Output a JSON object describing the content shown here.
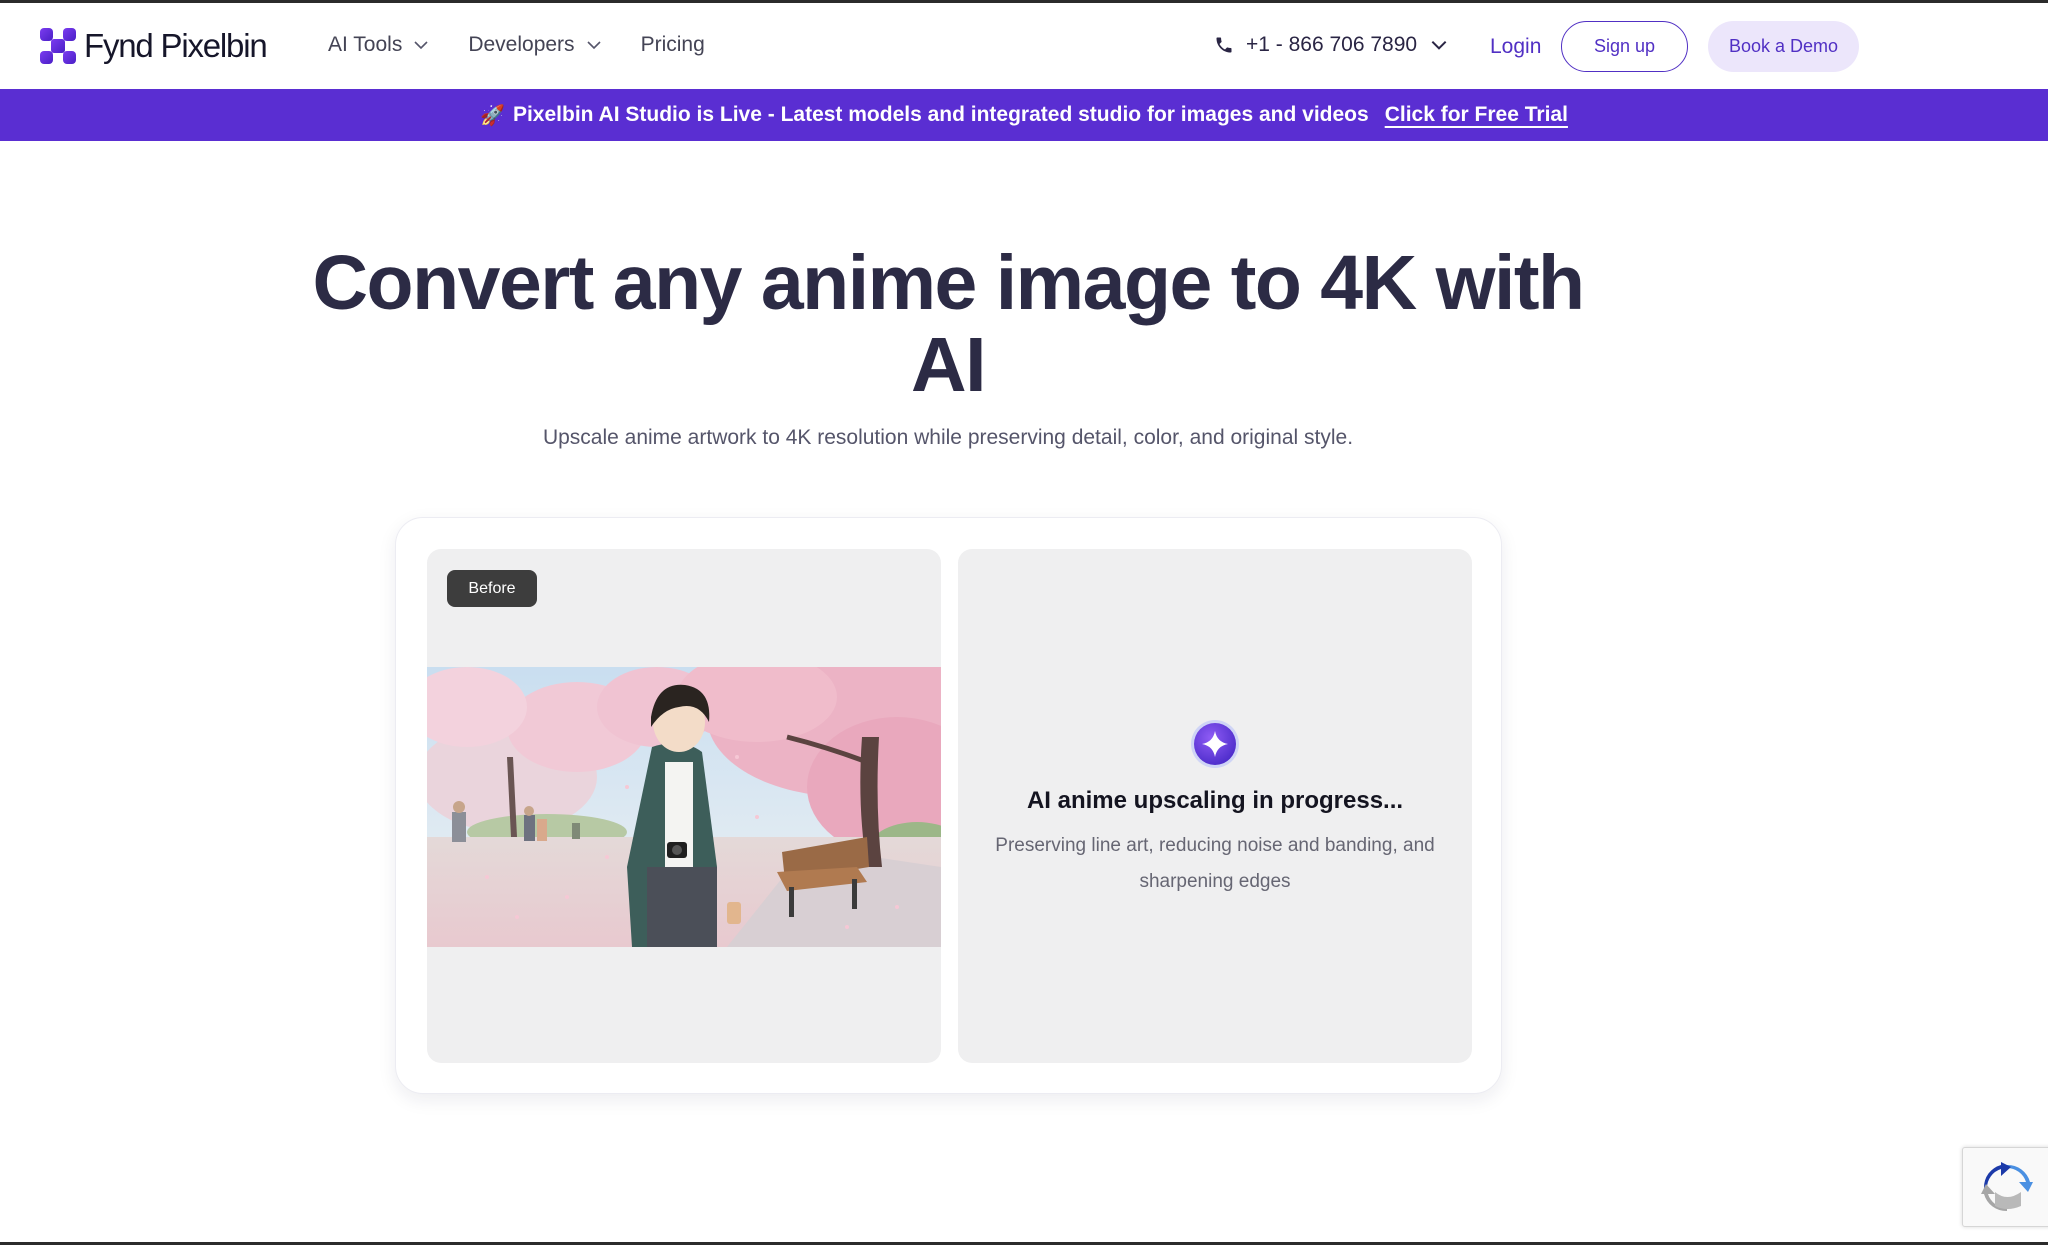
{
  "brand": {
    "name": "Fynd Pixelbin"
  },
  "nav": {
    "links": [
      {
        "label": "AI Tools",
        "has_dropdown": true
      },
      {
        "label": "Developers",
        "has_dropdown": true
      },
      {
        "label": "Pricing",
        "has_dropdown": false
      }
    ],
    "phone": "+1 - 866 706 7890",
    "login": "Login",
    "signup": "Sign up",
    "demo": "Book a Demo"
  },
  "banner": {
    "icon": "rocket-icon",
    "text": "Pixelbin AI Studio is Live - Latest models and integrated studio for images and videos",
    "cta": "Click for Free Trial"
  },
  "hero": {
    "title": "Convert any anime image to 4K with AI",
    "subtitle": "Upscale anime artwork to 4K resolution while preserving detail, color, and original style."
  },
  "preview": {
    "before_label": "Before",
    "image_alt": "anime boy under cherry blossom trees",
    "progress_title": "AI anime upscaling in progress...",
    "progress_desc": "Preserving line art, reducing noise and banding, and sharpening edges"
  },
  "colors": {
    "accent": "#5130c4",
    "banner_bg": "#5a2ed2",
    "title": "#2c2b45"
  }
}
